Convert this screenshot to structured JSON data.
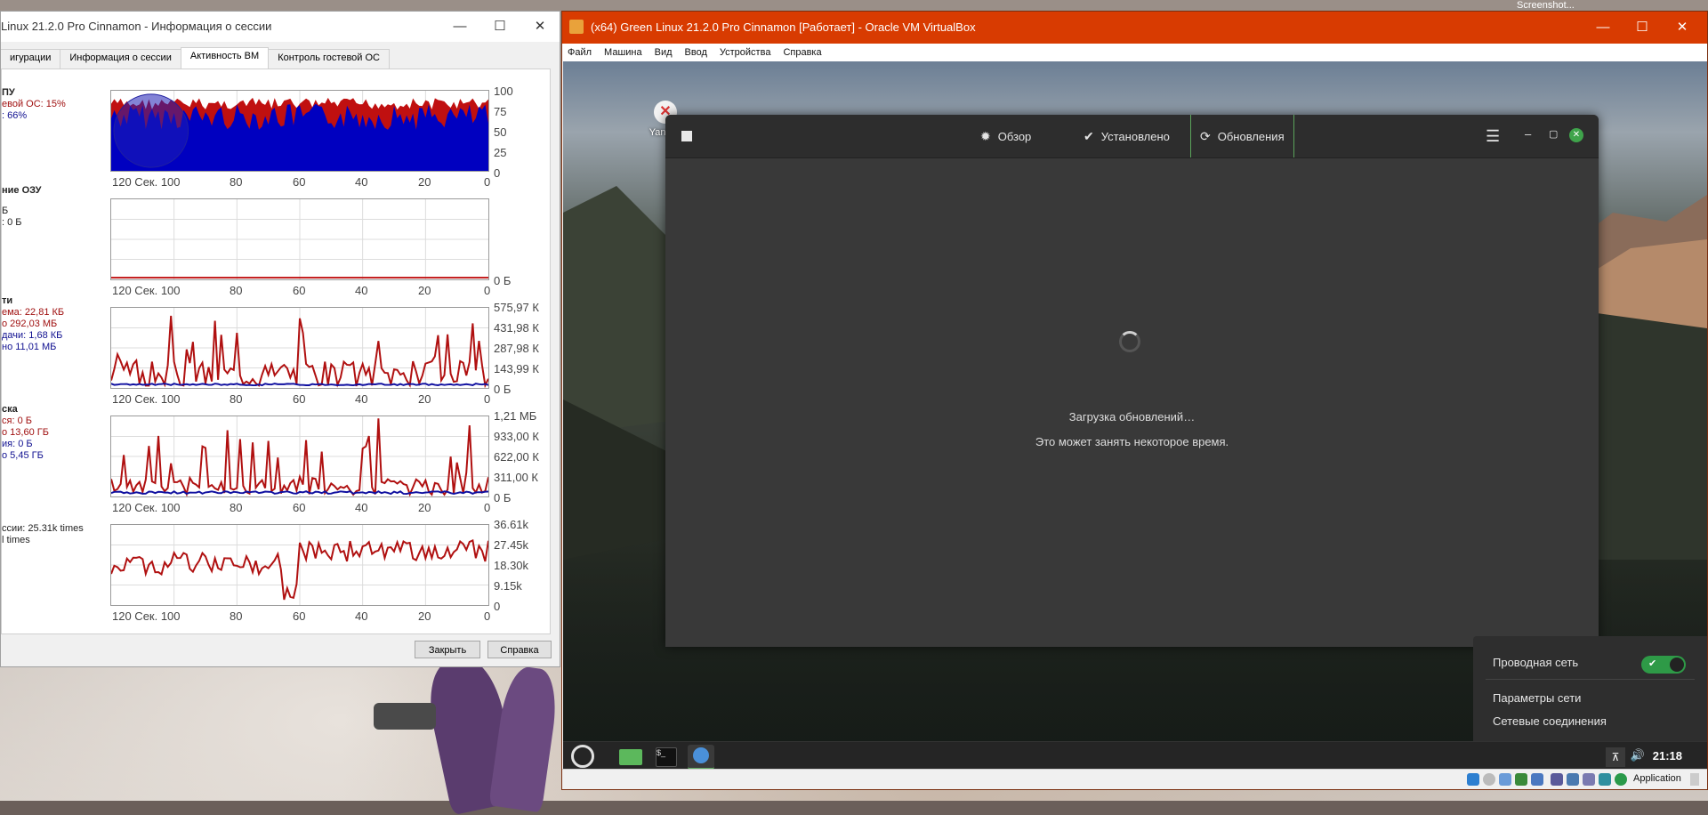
{
  "host": {
    "screenshot_label": "Screenshot..."
  },
  "session_window": {
    "title": "Linux 21.2.0 Pro Cinnamon - Информация о сессии",
    "tabs": [
      "игурации",
      "Информация о сессии",
      "Активность ВМ",
      "Контроль гостевой ОС"
    ],
    "active_tab_index": 2,
    "metrics": [
      {
        "lines": [
          {
            "text": "ПУ",
            "color": "dark",
            "bold": true
          },
          {
            "text": "евой ОС: 15%",
            "color": "red"
          },
          {
            "text": ": 66%",
            "color": "blue"
          }
        ],
        "y_ticks": [
          "100",
          "75",
          "50",
          "25",
          "0"
        ]
      },
      {
        "lines": [
          {
            "text": "ние ОЗУ",
            "color": "dark",
            "bold": true
          },
          {
            "text": "Б",
            "color": "dark"
          },
          {
            "text": ": 0 Б",
            "color": "dark"
          }
        ],
        "y_ticks": [
          "0 Б"
        ]
      },
      {
        "lines": [
          {
            "text": "ти",
            "color": "dark",
            "bold": true
          },
          {
            "text": "ема: 22,81 КБ",
            "color": "red"
          },
          {
            "text": "о 292,03 МБ",
            "color": "red"
          },
          {
            "text": "дачи: 1,68 КБ",
            "color": "blue"
          },
          {
            "text": "но 11,01 МБ",
            "color": "blue"
          }
        ],
        "y_ticks": [
          "575,97 К",
          "431,98 К",
          "287,98 К",
          "143,99 К",
          "0 Б"
        ]
      },
      {
        "lines": [
          {
            "text": "ска",
            "color": "dark",
            "bold": true
          },
          {
            "text": "ся: 0 Б",
            "color": "red"
          },
          {
            "text": "о 13,60 ГБ",
            "color": "red"
          },
          {
            "text": "ия: 0 Б",
            "color": "blue"
          },
          {
            "text": "о 5,45 ГБ",
            "color": "blue"
          }
        ],
        "y_ticks": [
          "1,21 МБ",
          "933,00 К",
          "622,00 К",
          "311,00 К",
          "0 Б"
        ]
      },
      {
        "lines": [
          {
            "text": "ссии: 25.31k times",
            "color": "dark"
          },
          {
            "text": "l times",
            "color": "dark"
          }
        ],
        "y_ticks": [
          "36.61k",
          "27.45k",
          "18.30k",
          "9.15k",
          "0"
        ]
      }
    ],
    "x_ticks": [
      "120 Сек. 100",
      "80",
      "60",
      "40",
      "20",
      "0"
    ],
    "buttons": {
      "close": "Закрыть",
      "help": "Справка"
    }
  },
  "vbox_window": {
    "title": "(x64) Green Linux 21.2.0 Pro Cinnamon [Работает] - Oracle VM VirtualBox",
    "menu": [
      "Файл",
      "Машина",
      "Вид",
      "Ввод",
      "Устройства",
      "Справка"
    ],
    "status_text": "Application"
  },
  "guest": {
    "desktop_icon_label": "Yandex",
    "update_manager": {
      "tabs": [
        {
          "label": "Обзор",
          "icon": "gear-icon"
        },
        {
          "label": "Установлено",
          "icon": "check-circle-icon"
        },
        {
          "label": "Обновления",
          "icon": "refresh-icon"
        }
      ],
      "active_tab_index": 2,
      "loading_title": "Загрузка обновлений…",
      "loading_subtitle": "Это может занять некоторое время."
    },
    "network_popup": {
      "wired_label": "Проводная сеть",
      "wired_enabled": true,
      "settings_label": "Параметры сети",
      "connections_label": "Сетевые соединения"
    },
    "clock": "21:18",
    "accent": "#2e9a47"
  }
}
